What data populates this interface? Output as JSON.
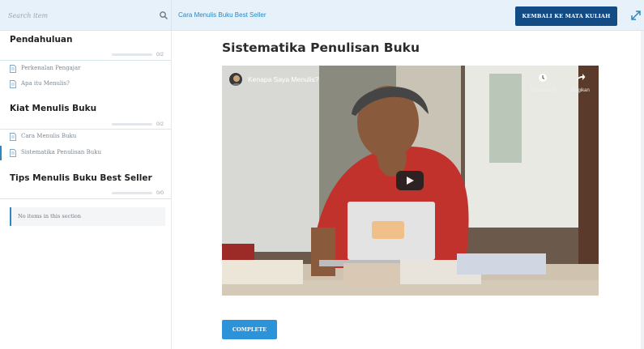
{
  "search": {
    "placeholder": "Search item"
  },
  "breadcrumb": "Cara Menulis Buku Best Seller",
  "header": {
    "back_label": "KEMBALI KE MATA KULIAH"
  },
  "sidebar": {
    "sections": [
      {
        "title": "Pendahuluan",
        "count": "0/2",
        "items": [
          {
            "label": "Perkenalan Pengajar"
          },
          {
            "label": "Apa itu Menulis?"
          }
        ]
      },
      {
        "title": "Kiat Menulis Buku",
        "count": "0/2",
        "items": [
          {
            "label": "Cara Menulis Buku"
          },
          {
            "label": "Sistematika Penulisan Buku"
          }
        ]
      },
      {
        "title": "Tips Menulis Buku Best Seller",
        "count": "0/0",
        "empty_text": "No items in this section"
      }
    ]
  },
  "lesson": {
    "title": "Sistematika Penulisan Buku",
    "video": {
      "title": "Kenapa Saya Menulis?",
      "watch_later": "Tonton nanti",
      "share": "Bagikan"
    },
    "complete_label": "COMPLETE"
  },
  "colors": {
    "accent": "#2e86c1",
    "header_button": "#134b84",
    "complete_button": "#2d93d8",
    "topbar": "#e6f1f9"
  },
  "icons": [
    "search-icon",
    "expand-icon",
    "document-icon",
    "clock-icon",
    "share-icon",
    "play-icon"
  ]
}
